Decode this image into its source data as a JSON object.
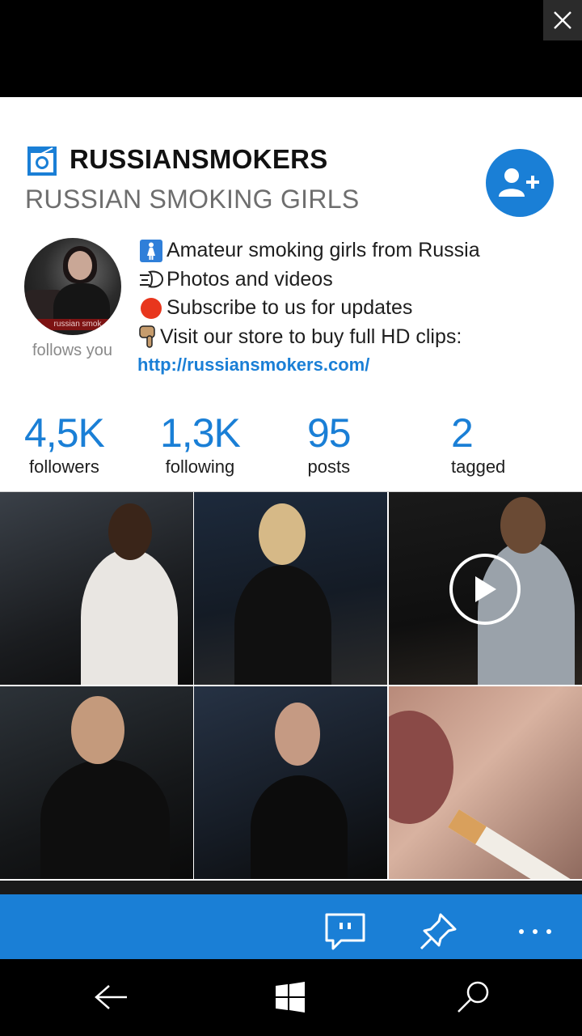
{
  "profile": {
    "username": "RUSSIANSMOKERS",
    "full_name": "RUSSIAN SMOKING GIRLS",
    "avatar_banner": "russian smok",
    "follows_you": "follows you",
    "bio": [
      {
        "icon": "woman-symbol-icon",
        "text": "Amateur smoking girls from Russia"
      },
      {
        "icon": "dash-puff-icon",
        "text": "Photos and videos"
      },
      {
        "icon": "red-circle-icon",
        "text": "Subscribe to us for updates"
      },
      {
        "icon": "pointing-down-icon",
        "text": "Visit our store to buy full HD clips:"
      }
    ],
    "website": "http://russiansmokers.com/"
  },
  "stats": [
    {
      "value": "4,5K",
      "label": "followers"
    },
    {
      "value": "1,3K",
      "label": "following"
    },
    {
      "value": "95",
      "label": "posts"
    },
    {
      "value": "2",
      "label": "tagged"
    }
  ],
  "posts": [
    {
      "type": "photo"
    },
    {
      "type": "photo"
    },
    {
      "type": "video"
    },
    {
      "type": "photo"
    },
    {
      "type": "photo"
    },
    {
      "type": "photo"
    }
  ],
  "appbar": {
    "icons": [
      "comment-icon",
      "pin-icon",
      "more-icon"
    ],
    "more_label": "..."
  },
  "colors": {
    "accent": "#1a7fd6",
    "text": "#1e1e1e",
    "subtext": "#6e6e6e"
  }
}
